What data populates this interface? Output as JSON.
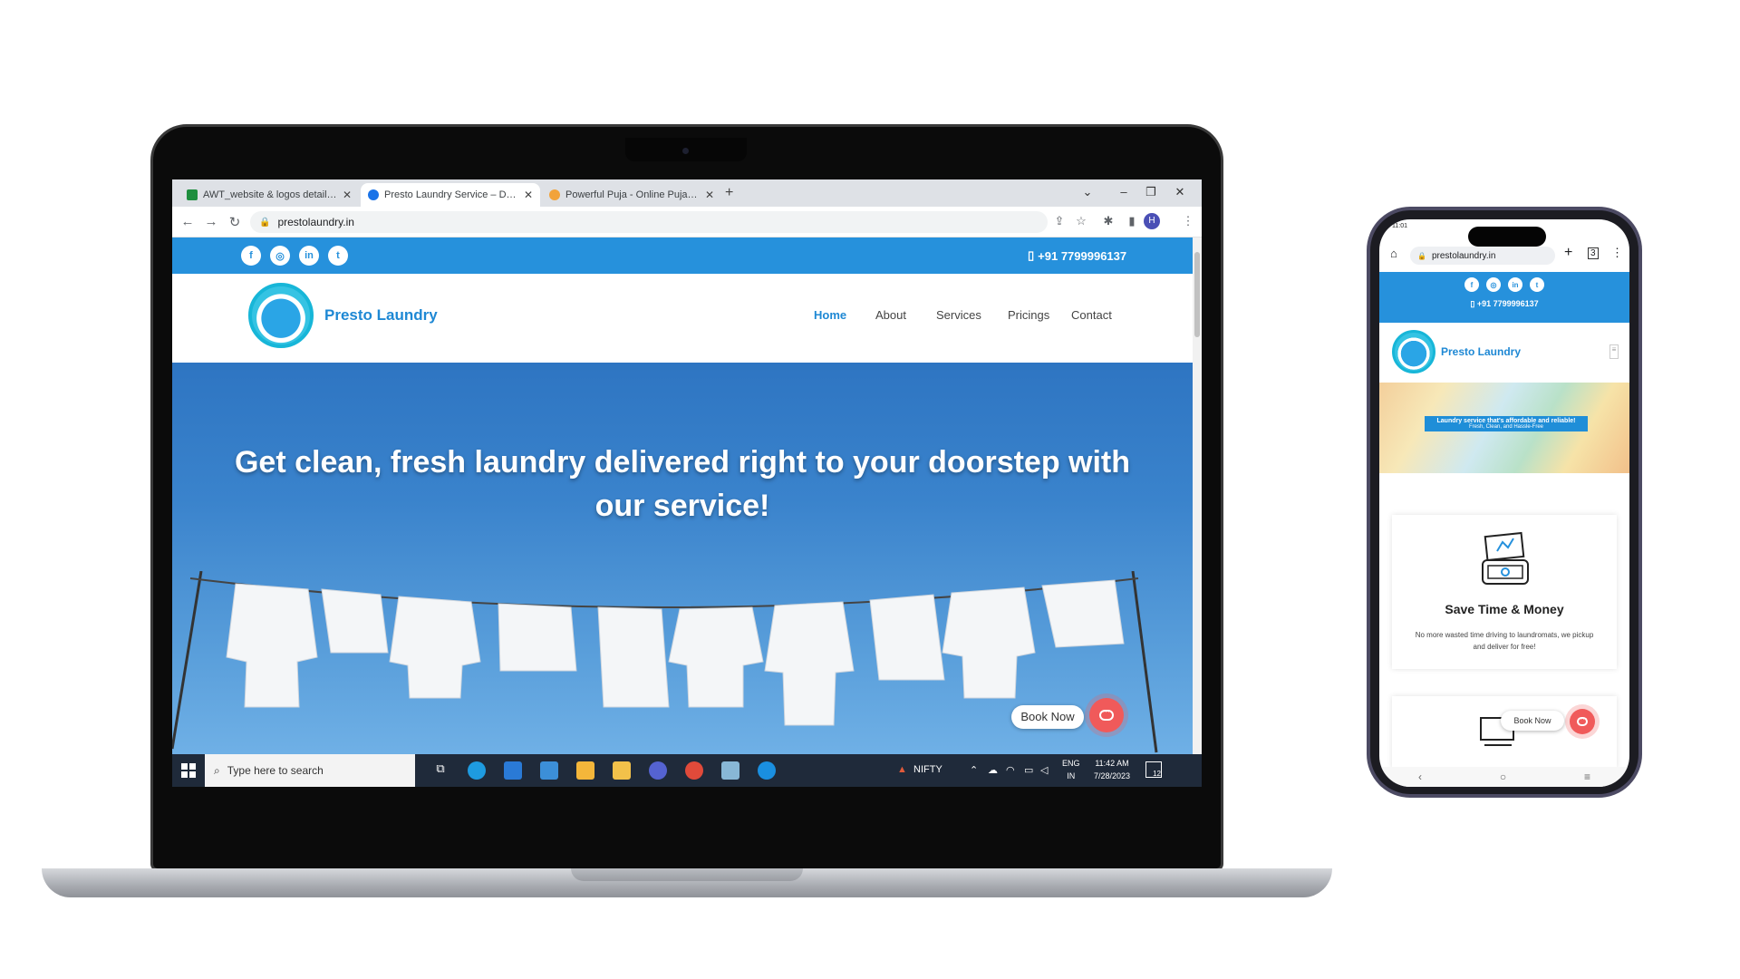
{
  "browser": {
    "tabs": [
      {
        "title": "AWT_website & logos details - G",
        "favicon_color": "#1e8e3e"
      },
      {
        "title": "Presto Laundry Service – Dry Cle",
        "favicon_color": "#1a73e8"
      },
      {
        "title": "Powerful Puja - Online Puja Servi",
        "favicon_color": "#f2a33a"
      }
    ],
    "new_tab": "+",
    "window_controls": {
      "dropdown": "⌄",
      "minimize": "–",
      "restore": "❐",
      "close": "✕"
    },
    "url": "prestolaundry.in",
    "profile_initial": "H"
  },
  "site": {
    "phone": "+91 7799996137",
    "social_icons": [
      "facebook-icon",
      "instagram-icon",
      "linkedin-icon",
      "twitter-icon"
    ],
    "social_glyphs": [
      "f",
      "◎",
      "in",
      "t"
    ],
    "brand": "Presto Laundry",
    "menu": [
      "Home",
      "About",
      "Services",
      "Pricings",
      "Contact"
    ],
    "hero_heading": "Get clean, fresh laundry delivered right to your doorstep with our service!",
    "book_now": "Book Now",
    "accent_color": "#2691dc",
    "chat_color": "#f05a5a"
  },
  "taskbar": {
    "search_placeholder": "Type here to search",
    "ticker": "NIFTY",
    "language": "ENG",
    "region": "IN",
    "time": "11:42 AM",
    "date": "7/28/2023",
    "notifications": "12"
  },
  "phone": {
    "status_time": "11:01",
    "url": "prestolaundry.in",
    "phone_number": "+91 7799996137",
    "brand": "Presto Laundry",
    "banner_title": "Laundry service that's affordable and reliable!",
    "banner_subtitle": "Fresh, Clean, and Hassle-Free",
    "card_title": "Save Time & Money",
    "card_text": "No more wasted time driving to laundromats, we pickup and deliver for free!",
    "book_now": "Book Now"
  }
}
